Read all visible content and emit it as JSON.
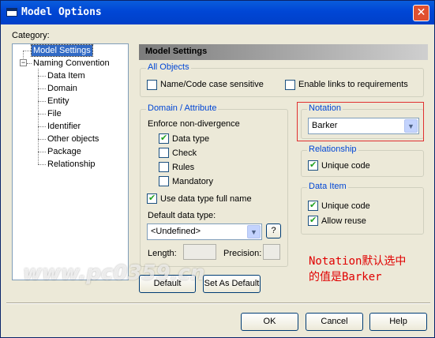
{
  "window": {
    "title": "Model Options",
    "close_glyph": "✕"
  },
  "category": {
    "label": "Category:",
    "tree": {
      "model_settings": "Model Settings",
      "naming_convention": "Naming Convention",
      "expander_glyph": "−",
      "children": [
        "Data Item",
        "Domain",
        "Entity",
        "File",
        "Identifier",
        "Other objects",
        "Package",
        "Relationship"
      ]
    }
  },
  "panel": {
    "title": "Model Settings"
  },
  "all_objects": {
    "title": "All Objects",
    "name_code_case": {
      "label": "Name/Code case sensitive",
      "checked": false
    },
    "enable_links": {
      "label": "Enable links to requirements",
      "checked": false
    }
  },
  "domain_attribute": {
    "title": "Domain / Attribute",
    "enforce_label": "Enforce non-divergence",
    "data_type": {
      "label": "Data type",
      "checked": true
    },
    "check": {
      "label": "Check",
      "checked": false
    },
    "rules": {
      "label": "Rules",
      "checked": false
    },
    "mandatory": {
      "label": "Mandatory",
      "checked": false
    },
    "use_full_name": {
      "label": "Use data type full name",
      "checked": true
    },
    "default_type_label": "Default data type:",
    "default_type_value": "<Undefined>",
    "browse_button": "?",
    "length_label": "Length:",
    "precision_label": "Precision:"
  },
  "notation": {
    "title": "Notation",
    "value": "Barker"
  },
  "relationship": {
    "title": "Relationship",
    "unique_code": {
      "label": "Unique code",
      "checked": true
    }
  },
  "data_item": {
    "title": "Data Item",
    "unique_code": {
      "label": "Unique code",
      "checked": true
    },
    "allow_reuse": {
      "label": "Allow reuse",
      "checked": true
    }
  },
  "buttons": {
    "default": "Default",
    "set_as_default": "Set As Default",
    "ok": "OK",
    "cancel": "Cancel",
    "help": "Help"
  },
  "annotation": "Notation默认选中\n的值是Barker",
  "watermark": "www.pc0359.cn",
  "colors": {
    "annotation": "#e00000",
    "titlebar": "#0046d5",
    "selection": "#316ac5"
  }
}
